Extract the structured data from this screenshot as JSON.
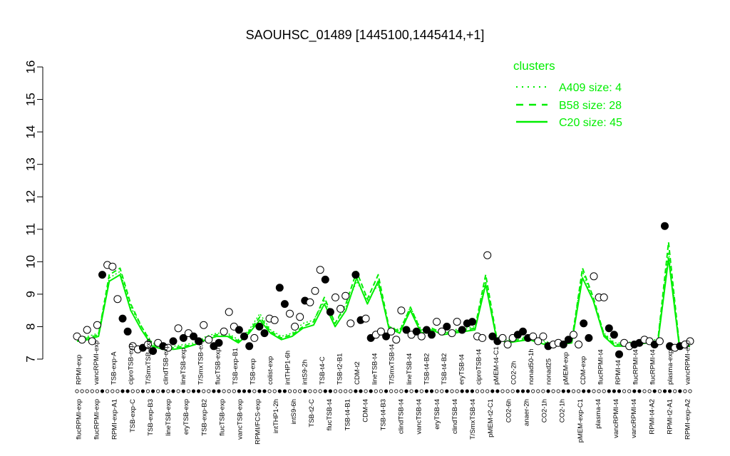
{
  "chart_data": {
    "type": "line",
    "title": "SAOUHSC_01489 [1445100,1445414,+1]",
    "xlabel": "",
    "ylabel": "",
    "ylim": [
      7,
      16
    ],
    "yticks": [
      "7",
      "8",
      "9",
      "10",
      "11",
      "12",
      "13",
      "14",
      "15",
      "16"
    ],
    "grid": false,
    "legend_position": "top-right",
    "legend": {
      "title": "clusters",
      "entries": [
        "A409 size: 4",
        "B58 size: 28",
        "C20 size: 45"
      ],
      "styles": [
        "dotted",
        "dashed",
        "solid"
      ]
    },
    "colors": {
      "series": "#00ee00",
      "axis": "#000000",
      "marker_stroke": "#000000"
    },
    "bottom_labels": [
      "flucRPMI-exp",
      "flucRPMI-exp",
      "RPMI-exp-A1",
      "TSB-exp-C",
      "TSB-exp-B3",
      "lineTSB-exp",
      "eryTSB-exp",
      "TSB-exp-B2",
      "flucTSB-exp",
      "vancTSB-exp",
      "RPMI/FCS-exp",
      "intTHP1-2h",
      "intS9-6h",
      "TSB-t2-C",
      "flucTSB-t4",
      "TSB-t4-B1",
      "CDM-t4",
      "TSB-t4-B3",
      "clindTSB-t4",
      "vancTSB-t4",
      "eryTSB-t4",
      "clindTSB-t4",
      "T/SmxTSB-t4",
      "pMEM-t2-C1",
      "CO2-6h",
      "anaer-2h",
      "CO2-1h",
      "CO2-1h",
      "pMEM-exp-C1",
      "plasma-t4",
      "vancRPMI-t4",
      "vancRPMI-t4",
      "RPMI-t4-A2",
      "RPMI-t2-A1",
      "RPMI-exp-A2"
    ],
    "top_labels": [
      "RPMI-exp",
      "vancRPMI-exp",
      "TSB-exp-A",
      "ciproTSB-exp",
      "T/SmxTSB-exp",
      "clindTSB-exp",
      "lineTSB-exp",
      "T/SmxTSB-exp",
      "flucTSB-exp",
      "TSB-exp-B1",
      "TSB-exp",
      "colist-exp",
      "intTHP1-6h",
      "intS9-2h",
      "TSB-t4-C",
      "TSB-t2-B1",
      "CDM-t2",
      "lineTSB-t4",
      "T/SmxTSB-t4",
      "lineTSB-t4",
      "TSB-t4-B2",
      "TSB-t4-B2",
      "eryTSB-t4",
      "ciproTSB-t4",
      "pMEM-t4-C1",
      "CO2-2h",
      "nonad50-1h",
      "nonad25",
      "pMEM-exp",
      "CDM-exp",
      "flucRPMI-t4",
      "RPMI-t4",
      "flucRPMI-t4",
      "flucRPMI-t4",
      "plasma-exp",
      "vancRPMI-exp"
    ],
    "points": [
      {
        "y": 7.7,
        "cluster": "A409"
      },
      {
        "y": 7.6,
        "cluster": "C20"
      },
      {
        "y": 7.9,
        "cluster": "A409"
      },
      {
        "y": 7.55,
        "cluster": "C20"
      },
      {
        "y": 8.05,
        "cluster": "A409"
      },
      {
        "y": 9.6,
        "cluster": "B58"
      },
      {
        "y": 9.9,
        "cluster": "C20"
      },
      {
        "y": 9.85,
        "cluster": "C20"
      },
      {
        "y": 8.85,
        "cluster": "C20"
      },
      {
        "y": 8.25,
        "cluster": "B58"
      },
      {
        "y": 7.85,
        "cluster": "B58"
      },
      {
        "y": 7.4,
        "cluster": "C20"
      },
      {
        "y": 7.3,
        "cluster": "C20"
      },
      {
        "y": 7.35,
        "cluster": "B58"
      },
      {
        "y": 7.45,
        "cluster": "C20"
      },
      {
        "y": 7.25,
        "cluster": "B58"
      },
      {
        "y": 7.5,
        "cluster": "C20"
      },
      {
        "y": 7.4,
        "cluster": "B58"
      },
      {
        "y": 7.35,
        "cluster": "C20"
      },
      {
        "y": 7.55,
        "cluster": "B58"
      },
      {
        "y": 7.95,
        "cluster": "C20"
      },
      {
        "y": 7.65,
        "cluster": "B58"
      },
      {
        "y": 7.8,
        "cluster": "C20"
      },
      {
        "y": 7.7,
        "cluster": "B58"
      },
      {
        "y": 7.55,
        "cluster": "B58"
      },
      {
        "y": 8.05,
        "cluster": "C20"
      },
      {
        "y": 7.6,
        "cluster": "C20"
      },
      {
        "y": 7.4,
        "cluster": "B58"
      },
      {
        "y": 7.5,
        "cluster": "B58"
      },
      {
        "y": 7.85,
        "cluster": "C20"
      },
      {
        "y": 8.45,
        "cluster": "C20"
      },
      {
        "y": 8.0,
        "cluster": "C20"
      },
      {
        "y": 7.9,
        "cluster": "B58"
      },
      {
        "y": 7.7,
        "cluster": "B58"
      },
      {
        "y": 7.4,
        "cluster": "B58"
      },
      {
        "y": 7.65,
        "cluster": "C20"
      },
      {
        "y": 8.0,
        "cluster": "B58"
      },
      {
        "y": 7.8,
        "cluster": "B58"
      },
      {
        "y": 8.25,
        "cluster": "C20"
      },
      {
        "y": 8.2,
        "cluster": "C20"
      },
      {
        "y": 9.2,
        "cluster": "B58"
      },
      {
        "y": 8.7,
        "cluster": "B58"
      },
      {
        "y": 8.4,
        "cluster": "C20"
      },
      {
        "y": 8.0,
        "cluster": "C20"
      },
      {
        "y": 8.3,
        "cluster": "C20"
      },
      {
        "y": 8.8,
        "cluster": "B58"
      },
      {
        "y": 8.75,
        "cluster": "C20"
      },
      {
        "y": 9.1,
        "cluster": "C20"
      },
      {
        "y": 9.75,
        "cluster": "C20"
      },
      {
        "y": 9.45,
        "cluster": "B58"
      },
      {
        "y": 8.45,
        "cluster": "B58"
      },
      {
        "y": 8.9,
        "cluster": "C20"
      },
      {
        "y": 8.55,
        "cluster": "C20"
      },
      {
        "y": 8.95,
        "cluster": "C20"
      },
      {
        "y": 8.1,
        "cluster": "C20"
      },
      {
        "y": 9.6,
        "cluster": "B58"
      },
      {
        "y": 8.2,
        "cluster": "B58"
      },
      {
        "y": 8.25,
        "cluster": "C20"
      },
      {
        "y": 7.65,
        "cluster": "B58"
      },
      {
        "y": 7.75,
        "cluster": "C20"
      },
      {
        "y": 7.85,
        "cluster": "C20"
      },
      {
        "y": 7.7,
        "cluster": "B58"
      },
      {
        "y": 7.85,
        "cluster": "C20"
      },
      {
        "y": 7.6,
        "cluster": "C20"
      },
      {
        "y": 8.5,
        "cluster": "C20"
      },
      {
        "y": 7.9,
        "cluster": "B58"
      },
      {
        "y": 7.75,
        "cluster": "C20"
      },
      {
        "y": 7.85,
        "cluster": "B58"
      },
      {
        "y": 7.7,
        "cluster": "C20"
      },
      {
        "y": 7.9,
        "cluster": "B58"
      },
      {
        "y": 7.75,
        "cluster": "B58"
      },
      {
        "y": 8.15,
        "cluster": "C20"
      },
      {
        "y": 7.85,
        "cluster": "C20"
      },
      {
        "y": 8.0,
        "cluster": "B58"
      },
      {
        "y": 7.8,
        "cluster": "C20"
      },
      {
        "y": 8.15,
        "cluster": "C20"
      },
      {
        "y": 7.9,
        "cluster": "B58"
      },
      {
        "y": 8.1,
        "cluster": "B58"
      },
      {
        "y": 8.15,
        "cluster": "B58"
      },
      {
        "y": 7.7,
        "cluster": "C20"
      },
      {
        "y": 7.65,
        "cluster": "C20"
      },
      {
        "y": 10.2,
        "cluster": "C20"
      },
      {
        "y": 7.7,
        "cluster": "B58"
      },
      {
        "y": 7.55,
        "cluster": "B58"
      },
      {
        "y": 7.65,
        "cluster": "C20"
      },
      {
        "y": 7.45,
        "cluster": "C20"
      },
      {
        "y": 7.65,
        "cluster": "C20"
      },
      {
        "y": 7.75,
        "cluster": "B58"
      },
      {
        "y": 7.85,
        "cluster": "B58"
      },
      {
        "y": 7.65,
        "cluster": "B58"
      },
      {
        "y": 7.7,
        "cluster": "C20"
      },
      {
        "y": 7.55,
        "cluster": "C20"
      },
      {
        "y": 7.7,
        "cluster": "C20"
      },
      {
        "y": 7.4,
        "cluster": "B58"
      },
      {
        "y": 7.45,
        "cluster": "C20"
      },
      {
        "y": 7.5,
        "cluster": "C20"
      },
      {
        "y": 7.45,
        "cluster": "B58"
      },
      {
        "y": 7.6,
        "cluster": "B58"
      },
      {
        "y": 7.75,
        "cluster": "C20"
      },
      {
        "y": 7.45,
        "cluster": "C20"
      },
      {
        "y": 8.1,
        "cluster": "B58"
      },
      {
        "y": 7.65,
        "cluster": "B58"
      },
      {
        "y": 9.55,
        "cluster": "C20"
      },
      {
        "y": 8.9,
        "cluster": "C20"
      },
      {
        "y": 8.9,
        "cluster": "C20"
      },
      {
        "y": 7.95,
        "cluster": "B58"
      },
      {
        "y": 7.75,
        "cluster": "B58"
      },
      {
        "y": 7.15,
        "cluster": "B58"
      },
      {
        "y": 7.5,
        "cluster": "C20"
      },
      {
        "y": 7.4,
        "cluster": "C20"
      },
      {
        "y": 7.45,
        "cluster": "B58"
      },
      {
        "y": 7.5,
        "cluster": "B58"
      },
      {
        "y": 7.6,
        "cluster": "C20"
      },
      {
        "y": 7.55,
        "cluster": "C20"
      },
      {
        "y": 7.45,
        "cluster": "B58"
      },
      {
        "y": 7.55,
        "cluster": "C20"
      },
      {
        "y": 11.1,
        "cluster": "B58"
      },
      {
        "y": 7.4,
        "cluster": "B58"
      },
      {
        "y": 7.35,
        "cluster": "C20"
      },
      {
        "y": 7.4,
        "cluster": "B58"
      },
      {
        "y": 7.45,
        "cluster": "C20"
      },
      {
        "y": 7.55,
        "cluster": "C20"
      }
    ],
    "series": [
      {
        "name": "A409",
        "style": "dotted",
        "values": [
          7.65,
          7.7,
          7.8,
          9.5,
          9.7,
          8.6,
          8.0,
          7.5,
          7.4,
          7.4,
          7.45,
          7.5,
          7.7,
          7.8,
          7.8,
          7.6,
          7.9,
          8.4,
          7.9,
          7.7,
          7.8,
          8.1,
          8.2,
          8.8,
          8.1,
          8.6,
          9.4,
          8.8,
          9.3,
          8.0,
          7.9,
          8.6,
          7.9,
          7.95,
          7.8,
          7.9,
          7.95,
          8.0,
          9.4,
          7.7,
          7.6,
          7.65,
          7.7,
          7.6,
          7.5,
          7.5,
          7.6,
          9.7,
          8.8,
          7.8,
          7.5,
          7.5,
          7.55,
          7.6,
          7.6,
          10.3,
          7.5,
          7.5
        ]
      },
      {
        "name": "B58",
        "style": "dashed",
        "values": [
          7.6,
          7.65,
          7.75,
          9.6,
          9.8,
          8.7,
          8.0,
          7.45,
          7.35,
          7.35,
          7.4,
          7.45,
          7.65,
          7.75,
          7.75,
          7.55,
          7.85,
          8.3,
          7.85,
          7.65,
          7.75,
          8.0,
          8.15,
          8.9,
          8.1,
          8.7,
          9.7,
          8.85,
          9.6,
          8.0,
          7.85,
          8.6,
          7.85,
          7.95,
          7.8,
          7.85,
          7.9,
          7.95,
          9.6,
          7.7,
          7.55,
          7.6,
          7.65,
          7.55,
          7.45,
          7.45,
          7.55,
          9.8,
          8.9,
          7.75,
          7.45,
          7.45,
          7.5,
          7.55,
          7.55,
          10.6,
          7.45,
          7.45
        ]
      },
      {
        "name": "C20",
        "style": "solid",
        "values": [
          7.55,
          7.6,
          7.7,
          9.4,
          9.6,
          8.5,
          7.9,
          7.4,
          7.3,
          7.3,
          7.35,
          7.45,
          7.6,
          7.7,
          7.7,
          7.5,
          7.8,
          8.2,
          7.8,
          7.6,
          7.7,
          7.95,
          8.05,
          8.7,
          8.0,
          8.5,
          9.5,
          8.7,
          9.4,
          7.95,
          7.8,
          8.5,
          7.8,
          7.9,
          7.75,
          7.8,
          7.85,
          7.9,
          9.3,
          7.65,
          7.5,
          7.55,
          7.6,
          7.5,
          7.4,
          7.45,
          7.5,
          9.5,
          8.8,
          7.7,
          7.4,
          7.4,
          7.45,
          7.5,
          7.5,
          10.1,
          7.4,
          7.4
        ]
      }
    ]
  }
}
